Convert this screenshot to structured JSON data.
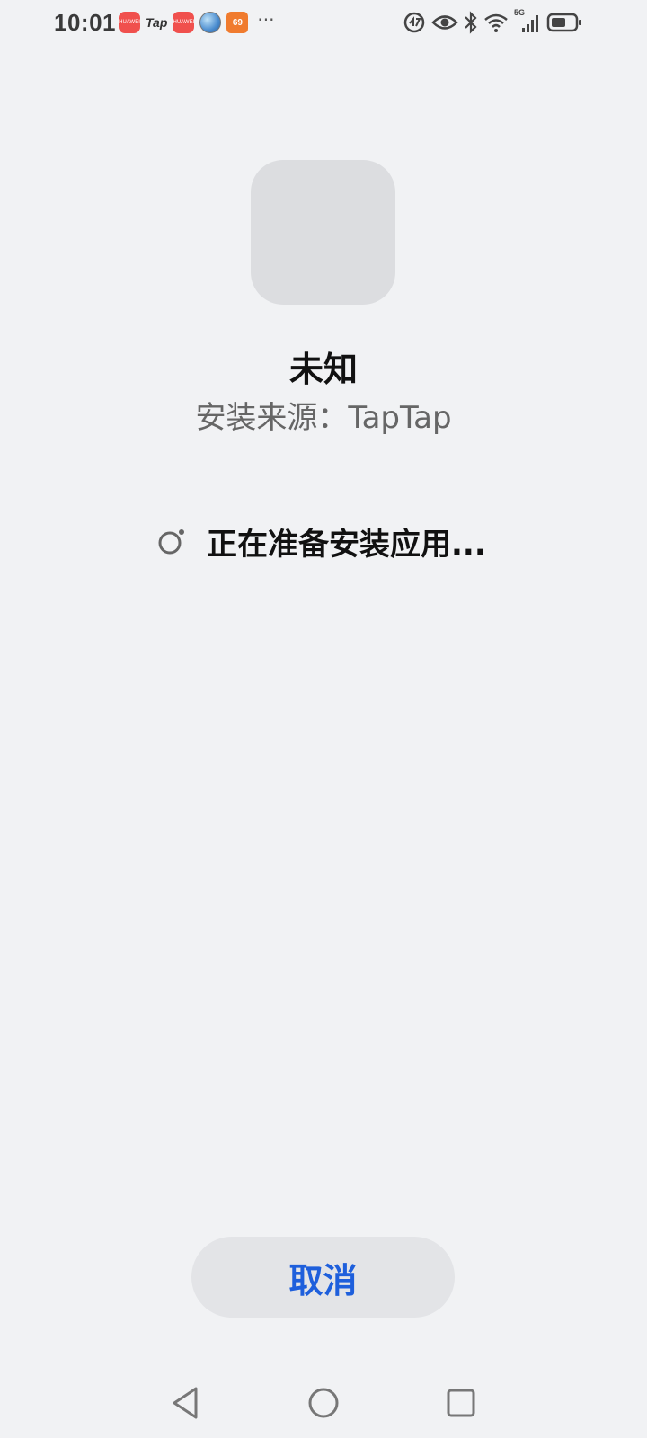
{
  "status_bar": {
    "time": "10:01",
    "notification_icons": [
      {
        "name": "huawei-appgallery-icon",
        "label": "HUAWEI"
      },
      {
        "name": "taptap-icon",
        "label": "Tap"
      },
      {
        "name": "huawei-appgallery-icon",
        "label": "HUAWEI"
      },
      {
        "name": "globe-app-icon"
      },
      {
        "name": "game-app-icon",
        "label": "69"
      }
    ],
    "more_indicator": "···",
    "system_icons": [
      "data-saver-icon",
      "eye-comfort-icon",
      "bluetooth-icon",
      "wifi-icon",
      "5g-signal-icon",
      "battery-icon"
    ],
    "network_label": "5G"
  },
  "app": {
    "name": "未知",
    "install_source": "安装来源：TapTap"
  },
  "progress": {
    "text": "正在准备安装应用..."
  },
  "actions": {
    "cancel_label": "取消"
  },
  "colors": {
    "background": "#f1f2f4",
    "accent": "#1e5fdc",
    "icon_placeholder": "#dcdde0",
    "button_bg": "#e3e4e7"
  }
}
